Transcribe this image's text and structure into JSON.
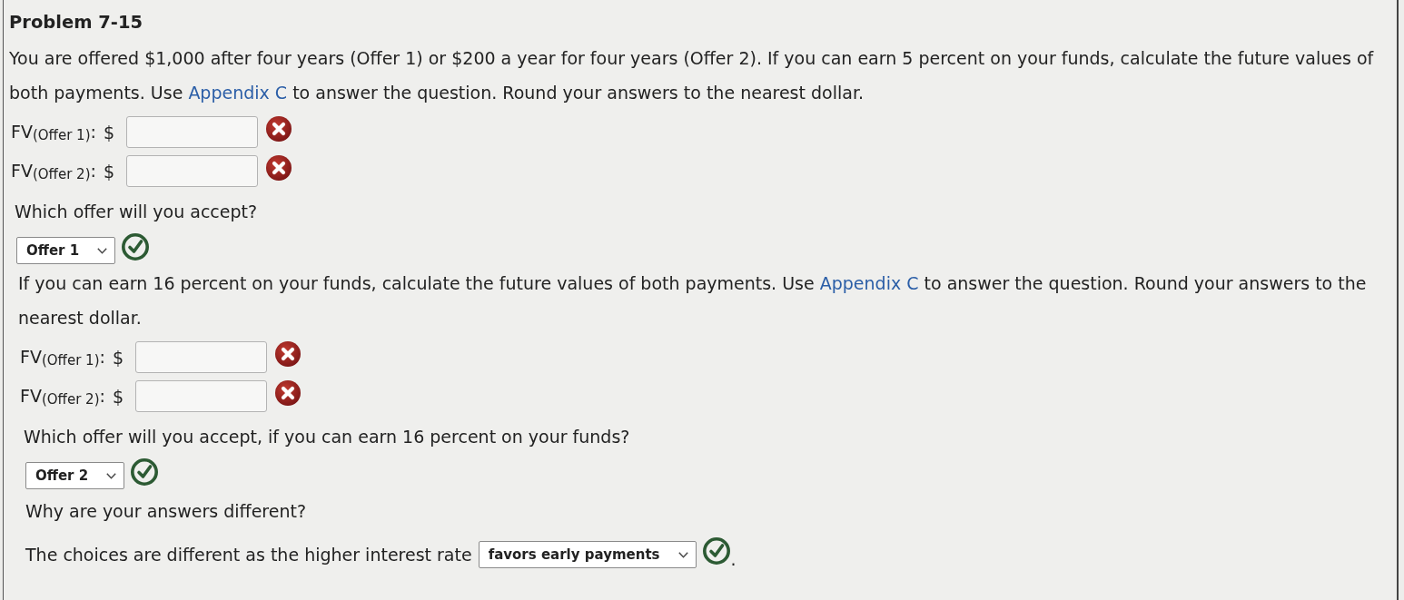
{
  "title": "Problem 7-15",
  "sections": [
    {
      "question": [
        {
          "kind": "text",
          "text": "You are offered $1,000 after four years (Offer 1) or $200 a year for four years (Offer 2). If you can earn 5 percent on your funds, calculate the future values of both payments. Use "
        },
        {
          "kind": "link",
          "text": "Appendix C"
        },
        {
          "kind": "text",
          "text": " to answer the question. Round your answers to the nearest dollar."
        }
      ],
      "answers": [
        {
          "label": "FV$_{(Offer 1)}$:",
          "currency": "$",
          "correct": false
        },
        {
          "label": "FV$_{(Offer 2)}$:",
          "currency": "$",
          "correct": false
        }
      ],
      "choice": {
        "prompt": "Which offer will you accept?",
        "value": "Offer 1",
        "correct": true
      }
    },
    {
      "question": [
        {
          "kind": "text",
          "text": "If you can earn 16 percent on your funds, calculate the future values of both payments. Use "
        },
        {
          "kind": "link",
          "text": "Appendix C"
        },
        {
          "kind": "text",
          "text": " to answer the question. Round your answers to the nearest dollar."
        }
      ],
      "answers": [
        {
          "label": "FV$_{(Offer 1)}$:",
          "currency": "$",
          "correct": false
        },
        {
          "label": "FV$_{(Offer 2)}$:",
          "currency": "$",
          "correct": false
        }
      ],
      "choice": {
        "prompt": "Which offer will you accept, if you can earn 16 percent on your funds?",
        "value": "Offer 2",
        "correct": true
      }
    }
  ],
  "explanation": {
    "prompt": "Why are your answers different?",
    "sentence": "The choices are different as the higher interest rate",
    "value": "favors early payments",
    "correct": true,
    "suffix": "."
  }
}
